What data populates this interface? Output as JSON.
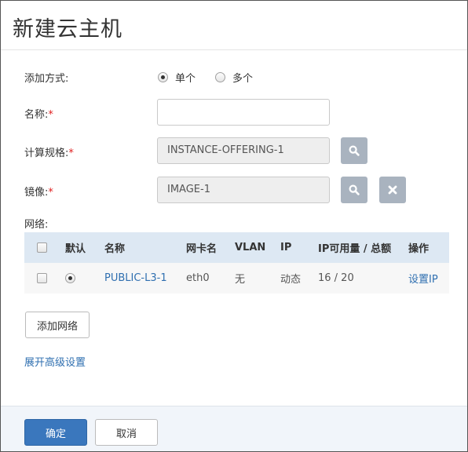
{
  "dialog": {
    "title": "新建云主机"
  },
  "form": {
    "add_mode": {
      "label": "添加方式:",
      "options": [
        {
          "label": "单个",
          "checked": true
        },
        {
          "label": "多个",
          "checked": false
        }
      ]
    },
    "name": {
      "label": "名称:",
      "required_mark": "*",
      "value": ""
    },
    "compute_offering": {
      "label": "计算规格:",
      "required_mark": "*",
      "value": "INSTANCE-OFFERING-1"
    },
    "image": {
      "label": "镜像:",
      "required_mark": "*",
      "value": "IMAGE-1"
    },
    "network": {
      "label": "网络:"
    }
  },
  "network_table": {
    "headers": [
      "",
      "默认",
      "名称",
      "网卡名",
      "VLAN",
      "IP",
      "IP可用量 / 总额",
      "操作"
    ],
    "rows": [
      {
        "default": true,
        "name": "PUBLIC-L3-1",
        "nic": "eth0",
        "vlan": "无",
        "ip": "动态",
        "ip_capacity": "16 / 20",
        "action": "设置IP"
      }
    ]
  },
  "buttons": {
    "add_network": "添加网络",
    "advanced": "展开高级设置",
    "confirm": "确定",
    "cancel": "取消"
  },
  "icons": {
    "search": "search-icon",
    "clear": "close-icon"
  },
  "colors": {
    "primary": "#3a77bd",
    "link": "#2f6fb0",
    "icon_button": "#a9b3bf",
    "table_header": "#dde8f3",
    "required": "#e02020",
    "footer_bg": "#f1f5fa"
  }
}
